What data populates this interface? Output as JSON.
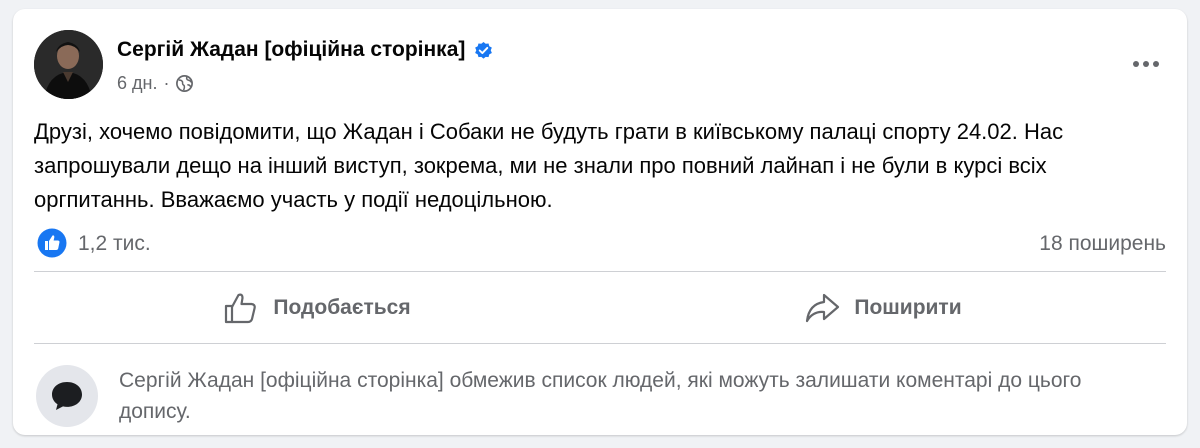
{
  "post": {
    "author": "Сергій Жадан [офіційна сторінка]",
    "time": "6 дн.",
    "separator": "·",
    "text": "Друзі, хочемо повідомити, що Жадан і Собаки не будуть грати в київському палаці спорту 24.02. Нас запрошували дещо на інший виступ, зокрема, ми не знали про повний лайнап і не були в курсі всіх оргпитаннь. Вважаємо участь у події недоцільною.",
    "reactions_count": "1,2 тис.",
    "shares_count": "18 поширень"
  },
  "actions": {
    "like_label": "Подобається",
    "share_label": "Поширити"
  },
  "comments": {
    "notice": "Сергій Жадан [офіційна сторінка] обмежив список людей, які можуть залишати коментарі до цього допису."
  },
  "icons": {
    "verified": "verified-badge-icon",
    "audience": "globe-icon",
    "more": "more-options-icon",
    "like_reaction": "like-reaction-icon",
    "like_action": "thumbs-up-icon",
    "share_action": "share-arrow-icon",
    "comment_restricted": "speech-bubble-icon"
  },
  "colors": {
    "accent_blue": "#1877f2",
    "secondary_text": "#65676b",
    "primary_text": "#050505",
    "background": "#f0f2f5"
  }
}
